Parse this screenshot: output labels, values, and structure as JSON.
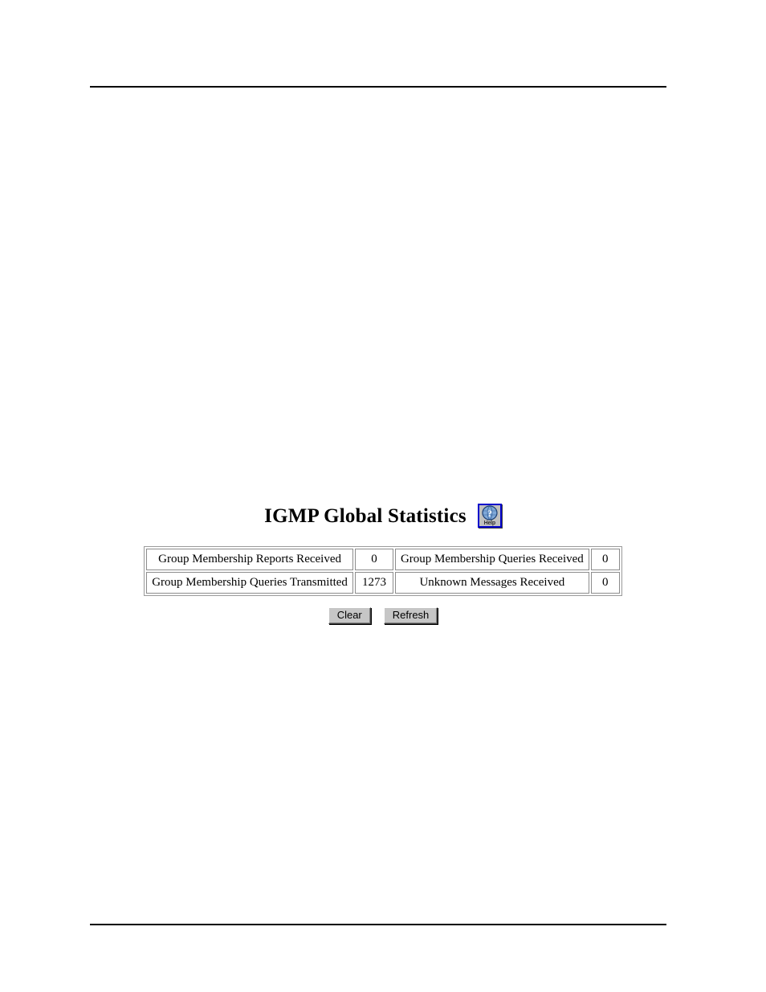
{
  "page": {
    "title": "IGMP Global Statistics",
    "rules": {
      "top_label": "header-rule",
      "bottom_label": "footer-rule"
    }
  },
  "help": {
    "icon_name": "help-icon",
    "label": "Help",
    "border_color": "#0000cc",
    "globe_color": "#4a6fb5",
    "question_mark": "?"
  },
  "stats_table": {
    "rows": [
      {
        "left_label": "Group Membership Reports Received",
        "left_value": "0",
        "right_label": "Group Membership Queries Received",
        "right_value": "0"
      },
      {
        "left_label": "Group Membership Queries Transmitted",
        "left_value": "1273",
        "right_label": "Unknown Messages Received",
        "right_value": "0"
      }
    ]
  },
  "buttons": {
    "clear_label": "Clear",
    "refresh_label": "Refresh"
  }
}
